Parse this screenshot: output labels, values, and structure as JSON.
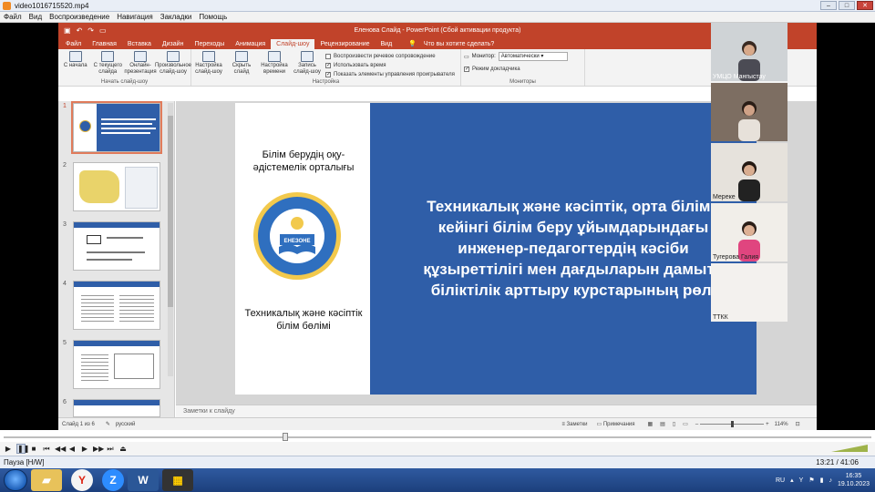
{
  "player": {
    "title": "video1016715520.mp4",
    "menu": [
      "Файл",
      "Вид",
      "Воспроизведение",
      "Навигация",
      "Закладки",
      "Помощь"
    ],
    "status_text": "Пауза [H/W]",
    "timecode": "13:21 / 41:06"
  },
  "ppt": {
    "window_title": "Еленова Слайд - PowerPoint (Сбой активации продукта)",
    "tabs": [
      "Файл",
      "Главная",
      "Вставка",
      "Дизайн",
      "Переходы",
      "Анимация",
      "Слайд-шоу",
      "Рецензирование",
      "Вид"
    ],
    "active_tab": "Слайд-шоу",
    "tell_me": "Что вы хотите сделать?",
    "ribbon": {
      "start_buttons": [
        "С начала",
        "С текущего слайда",
        "Онлайн-презентация",
        "Произвольное слайд-шоу"
      ],
      "start_group": "Начать слайд-шоу",
      "setup_buttons": [
        "Настройка слайд-шоу",
        "Скрыть слайд",
        "Настройка времени",
        "Запись слайд-шоу"
      ],
      "setup_checks": [
        "Воспроизвести речевое сопровождение",
        "Использовать время",
        "Показать элементы управления проигрывателя"
      ],
      "setup_group": "Настройка",
      "monitor_label": "Монитор:",
      "monitor_value": "Автоматически",
      "presenter_view": "Режим докладчика",
      "monitors_group": "Мониторы"
    },
    "thumbnails": [
      "1",
      "2",
      "3",
      "4",
      "5",
      "6"
    ],
    "notes_placeholder": "Заметки к слайду",
    "status": {
      "slide_counter": "Слайд 1 из 6",
      "language": "русский",
      "notes": "Заметки",
      "comments": "Примечания",
      "zoom": "114%"
    }
  },
  "slide": {
    "org_name": "Білім берудің оқу-әдістемелік орталығы",
    "logo_text": "ЕНЕЗОНЕ",
    "department": "Техникалық және кәсіптік білім бөлімі",
    "headline_lines": [
      "Техникалық және кәсіптік, орта білімн",
      "кейінгі білім беру ұйымдарындағы",
      "инженер-педагогтердің кәсіби",
      "құзыреттілігі мен дағдыларын дамыту",
      "біліктілік арттыру курстарының рөлі"
    ]
  },
  "participants": [
    {
      "name": "УМЦО Мангыстау"
    },
    {
      "name": ""
    },
    {
      "name": "Мереке"
    },
    {
      "name": "Тугерова Галия"
    },
    {
      "name": "ТТКК"
    }
  ],
  "taskbar": {
    "language": "RU",
    "time": "16:35",
    "date": "19.10.2023"
  },
  "colors": {
    "ppt_accent": "#c1432a",
    "slide_blue": "#2f5ea8"
  }
}
